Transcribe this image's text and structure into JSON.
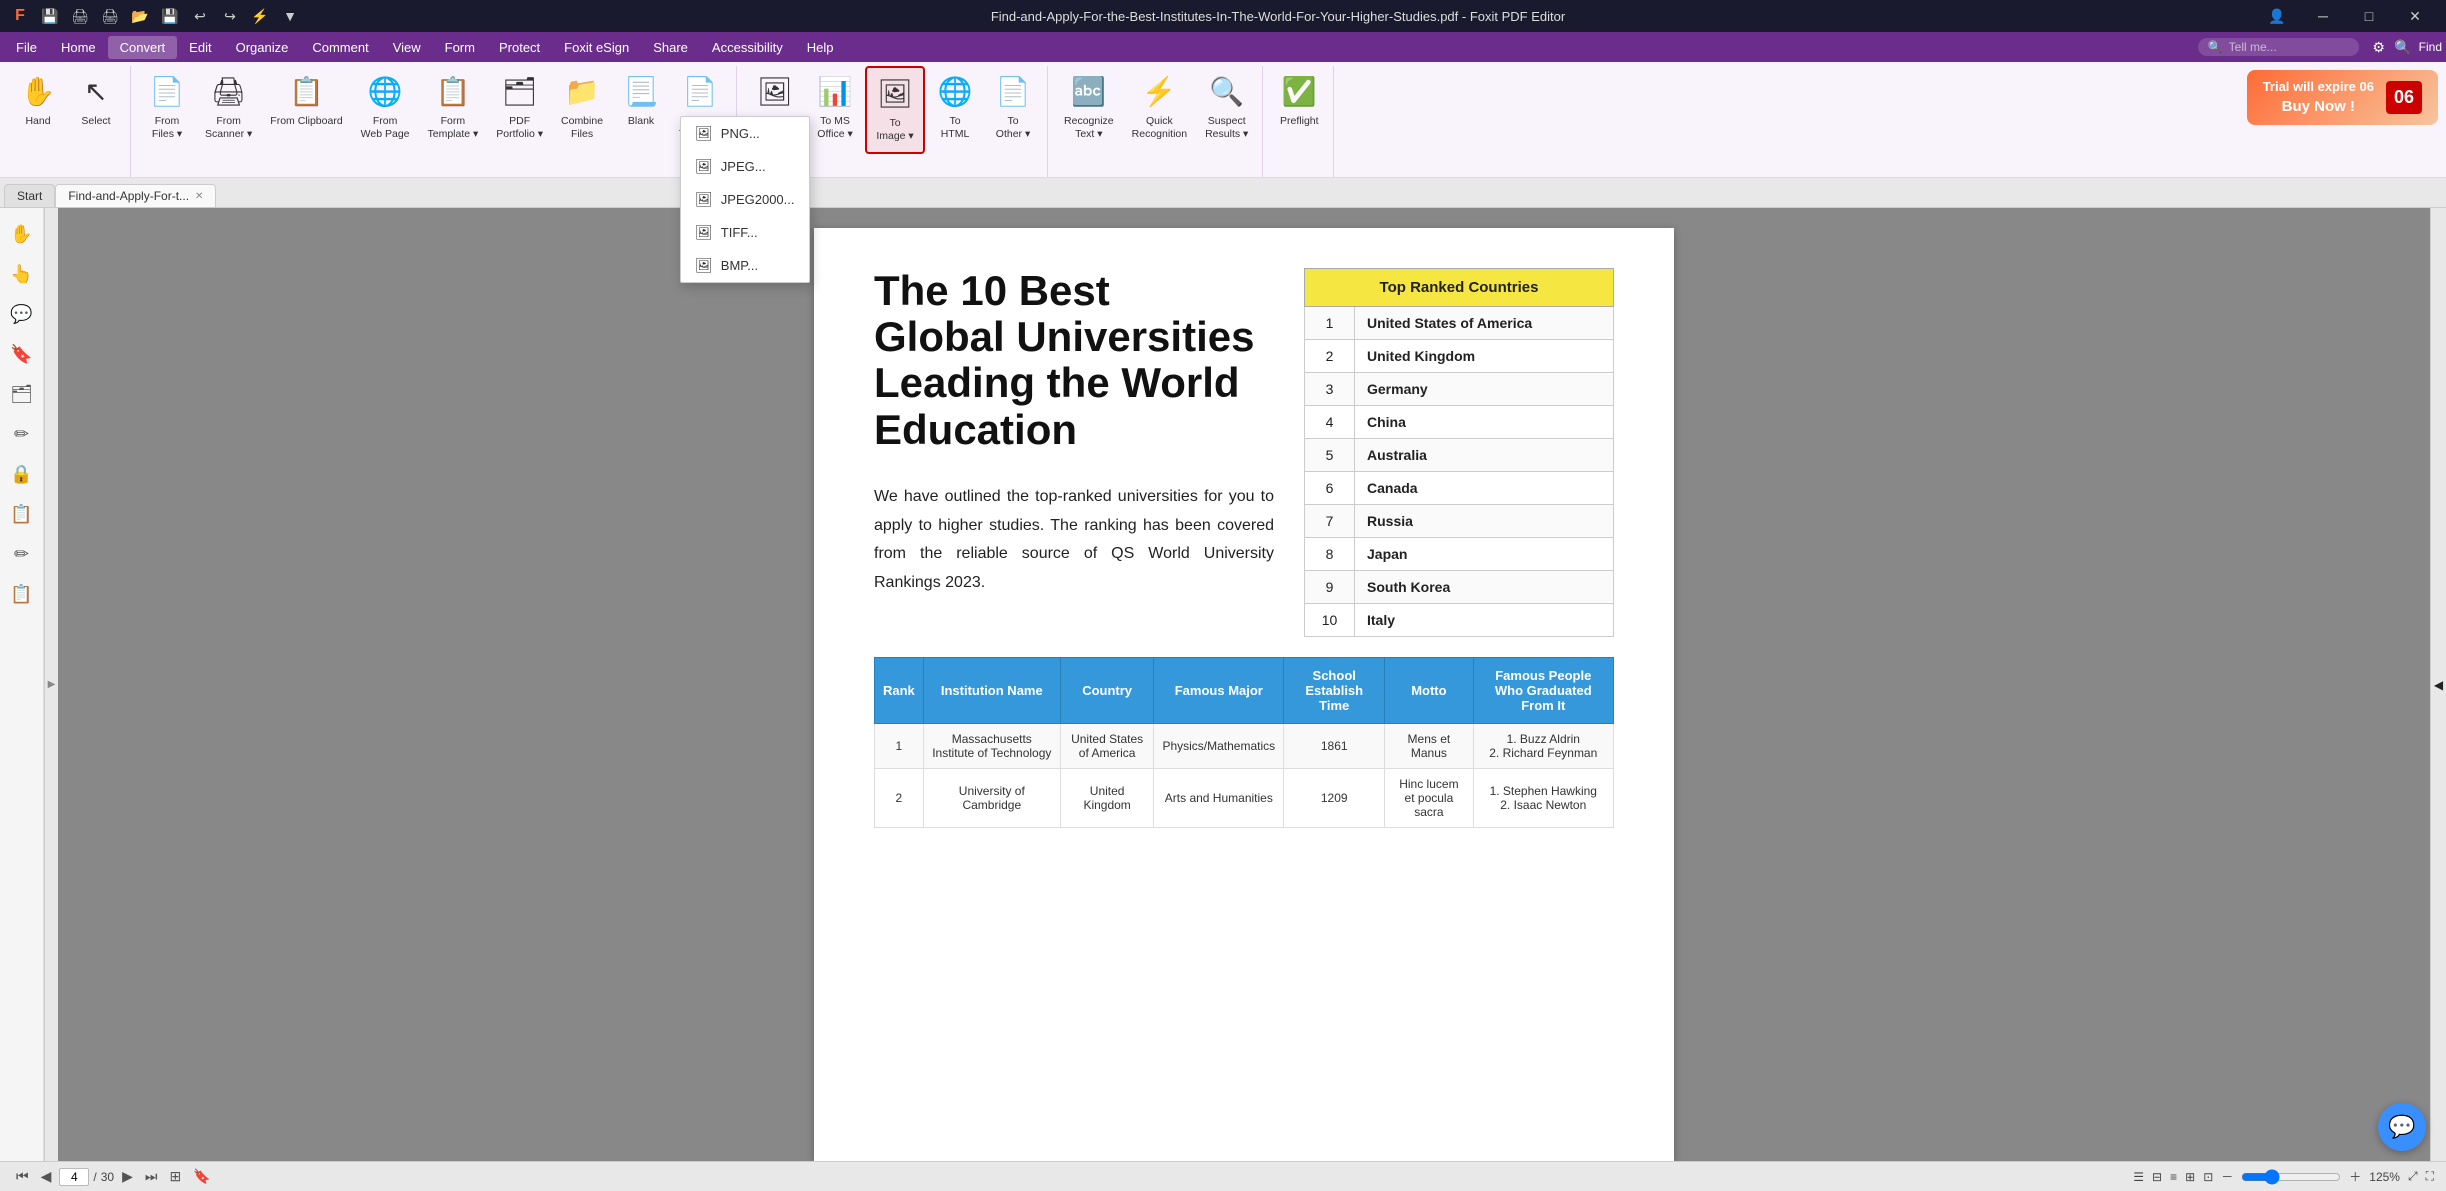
{
  "titlebar": {
    "title": "Find-and-Apply-For-the-Best-Institutes-In-The-World-For-Your-Higher-Studies.pdf - Foxit PDF Editor",
    "app_icon": "F",
    "minimize": "─",
    "maximize": "□",
    "close": "✕"
  },
  "quickaccess": {
    "icons": [
      "💾",
      "🖨",
      "🖨",
      "📂",
      "💾",
      "↩",
      "↪",
      "⚡",
      "▼"
    ]
  },
  "menubar": {
    "items": [
      "File",
      "Home",
      "Convert",
      "Edit",
      "Organize",
      "Comment",
      "View",
      "Form",
      "Protect",
      "Foxit eSign",
      "Share",
      "Accessibility",
      "Help"
    ],
    "active": "Convert",
    "search_placeholder": "Tell me..."
  },
  "ribbon": {
    "convert_tab": {
      "groups": [
        {
          "label": "",
          "buttons": [
            {
              "id": "hand",
              "label": "Hand",
              "icon": "✋"
            },
            {
              "id": "select",
              "label": "Select",
              "icon": "↖"
            }
          ]
        },
        {
          "label": "",
          "buttons": [
            {
              "id": "from-files",
              "label": "From\nFiles",
              "icon": "📄",
              "has_caret": true
            },
            {
              "id": "from-scanner",
              "label": "From\nScanner",
              "icon": "🖨",
              "has_caret": true
            },
            {
              "id": "from-clipboard",
              "label": "From\nClipboard",
              "icon": "📋"
            },
            {
              "id": "from-web-page",
              "label": "From\nWeb Page",
              "icon": "🌐"
            },
            {
              "id": "form",
              "label": "Form\nTemplate",
              "icon": "📋",
              "has_caret": true
            },
            {
              "id": "pdf-portfolio",
              "label": "PDF\nPortfolio",
              "icon": "🗂",
              "has_caret": true
            },
            {
              "id": "combine-files",
              "label": "Combine\nFiles",
              "icon": "📁"
            },
            {
              "id": "blank",
              "label": "Blank",
              "icon": "📃"
            },
            {
              "id": "from-template",
              "label": "From\nTemplate",
              "icon": "📄"
            }
          ]
        },
        {
          "label": "",
          "buttons": [
            {
              "id": "export-all-images",
              "label": "Export All\nImages",
              "icon": "🖼"
            },
            {
              "id": "to-ms-office",
              "label": "To MS\nOffice",
              "icon": "📊",
              "has_caret": true
            },
            {
              "id": "to-image",
              "label": "To\nImage",
              "icon": "🖼",
              "has_caret": true,
              "active": true
            },
            {
              "id": "to-html",
              "label": "To\nHTML",
              "icon": "🌐"
            },
            {
              "id": "to-other",
              "label": "To\nOther",
              "icon": "📄",
              "has_caret": true
            }
          ]
        },
        {
          "label": "",
          "buttons": [
            {
              "id": "recognize-text",
              "label": "Recognize\nText",
              "icon": "🔤",
              "has_caret": true
            },
            {
              "id": "quick-recognition",
              "label": "Quick\nRecognition",
              "icon": "⚡"
            },
            {
              "id": "suspect-results",
              "label": "Suspect\nResults",
              "icon": "🔍",
              "has_caret": true
            }
          ]
        },
        {
          "label": "",
          "buttons": [
            {
              "id": "preflight",
              "label": "Preflight",
              "icon": "✅"
            }
          ]
        }
      ]
    }
  },
  "trial": {
    "text": "Trial will expire 06",
    "button": "Buy Now !",
    "days": "06"
  },
  "tabs": {
    "start_label": "Start",
    "doc_label": "Find-and-Apply-For-t...",
    "close_label": "✕"
  },
  "dropdown": {
    "items": [
      {
        "id": "png",
        "label": "PNG...",
        "icon": "🖼"
      },
      {
        "id": "jpeg",
        "label": "JPEG...",
        "icon": "🖼"
      },
      {
        "id": "jpeg2000",
        "label": "JPEG2000...",
        "icon": "🖼"
      },
      {
        "id": "tiff",
        "label": "TIFF...",
        "icon": "🖼"
      },
      {
        "id": "bmp",
        "label": "BMP...",
        "icon": "🖼"
      }
    ]
  },
  "sidebar_icons": [
    "✋",
    "👆",
    "💬",
    "🔖",
    "🗂",
    "✏",
    "🔒",
    "📋",
    "✏",
    "📋"
  ],
  "pdf": {
    "title": "The 10 Best\nGlobal Universities\nLeading the World\nEducation",
    "paragraph": "We have outlined the top-ranked universities for you to apply to higher studies. The ranking has been covered from the reliable source of QS World University Rankings 2023.",
    "top_ranked": {
      "header": "Top Ranked Countries",
      "rows": [
        {
          "rank": "1",
          "country": "United States of America"
        },
        {
          "rank": "2",
          "country": "United Kingdom"
        },
        {
          "rank": "3",
          "country": "Germany"
        },
        {
          "rank": "4",
          "country": "China"
        },
        {
          "rank": "5",
          "country": "Australia"
        },
        {
          "rank": "6",
          "country": "Canada"
        },
        {
          "rank": "7",
          "country": "Russia"
        },
        {
          "rank": "8",
          "country": "Japan"
        },
        {
          "rank": "9",
          "country": "South Korea"
        },
        {
          "rank": "10",
          "country": "Italy"
        }
      ]
    },
    "institution_table": {
      "headers": [
        "Rank",
        "Institution Name",
        "Country",
        "Famous Major",
        "School Establish Time",
        "Motto",
        "Famous People Who Graduated From It"
      ],
      "rows": [
        {
          "rank": "1",
          "name": "Massachusetts Institute of Technology",
          "country": "United States of America",
          "major": "Physics/Mathematics",
          "year": "1861",
          "motto": "Mens et Manus",
          "people": "1. Buzz Aldrin\n2. Richard Feynman"
        },
        {
          "rank": "2",
          "name": "University of Cambridge",
          "country": "United Kingdom",
          "major": "Arts and Humanities",
          "year": "1209",
          "motto": "Hinc lucem et pocula sacra",
          "people": "1. Stephen Hawking\n2. Isaac Newton"
        }
      ]
    }
  },
  "status": {
    "page_current": "4",
    "page_total": "30",
    "zoom": "125%"
  }
}
